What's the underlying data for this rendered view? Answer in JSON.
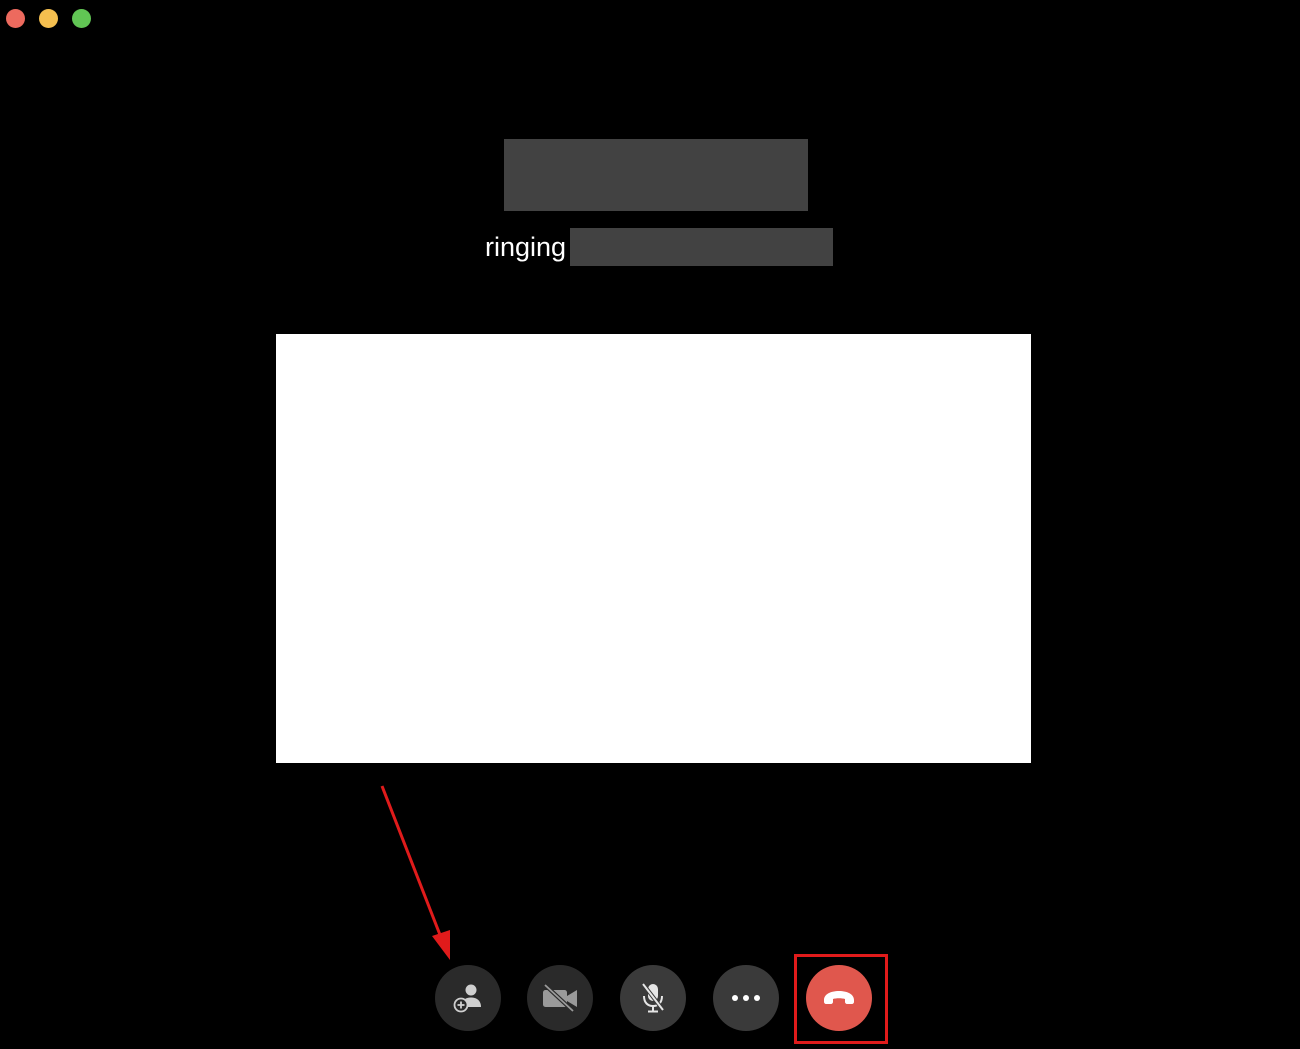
{
  "window": {
    "traffic_lights": [
      {
        "name": "close",
        "color": "#ed6a5e"
      },
      {
        "name": "minimize",
        "color": "#f5bf4f"
      },
      {
        "name": "zoom",
        "color": "#61c554"
      }
    ]
  },
  "call": {
    "status_label": "ringing"
  },
  "controls": {
    "add_person_icon": "person-add-icon",
    "video_icon": "video-off-icon",
    "mic_icon": "mic-off-icon",
    "more_icon": "more-horizontal-icon",
    "end_icon": "phone-hangup-icon"
  },
  "colors": {
    "background": "#000000",
    "redaction": "#424242",
    "end_call": "#e0574d",
    "annotation": "#e01b1b"
  }
}
